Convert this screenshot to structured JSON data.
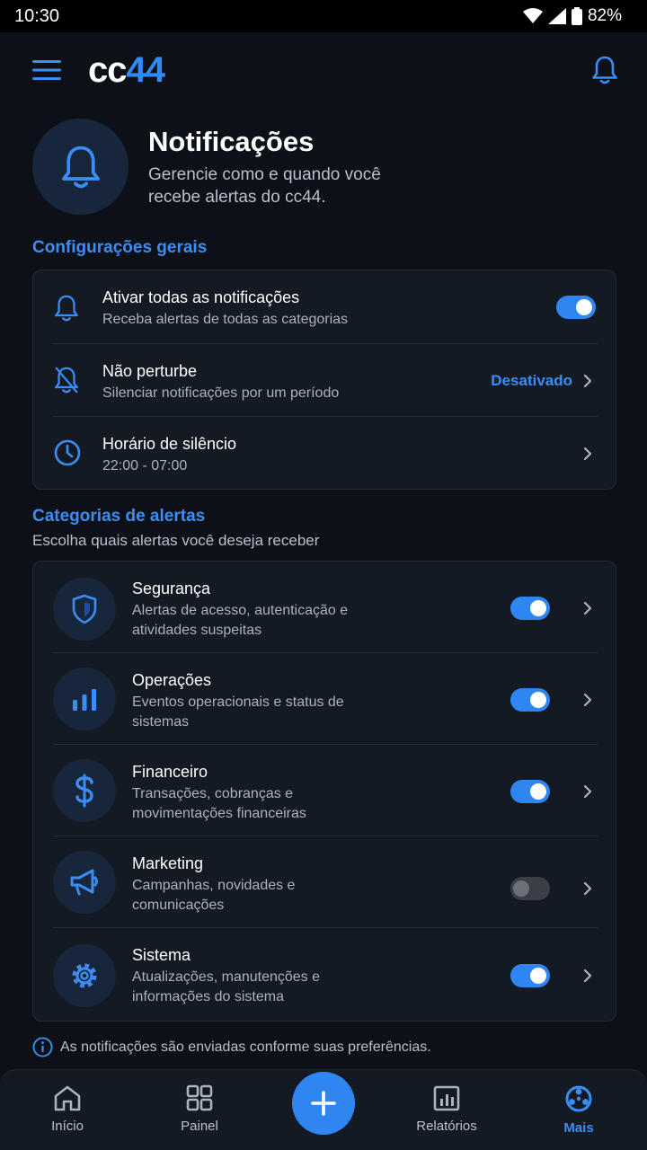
{
  "status_bar": {
    "time": "10:30",
    "battery": "82%"
  },
  "header": {
    "logo_cc": "cc",
    "logo_num": "44"
  },
  "hero": {
    "title": "Notificações",
    "subtitle": "Gerencie como e quando você recebe alertas do cc44."
  },
  "general": {
    "section_title": "Configurações gerais",
    "rows": [
      {
        "title": "Ativar todas as notificações",
        "subtitle": "Receba alertas de todas as categorias",
        "enabled": true
      },
      {
        "title": "Não perturbe",
        "subtitle": "Silenciar notificações por um período",
        "status": "Desativado"
      },
      {
        "title": "Horário de silêncio",
        "subtitle": "22:00 - 07:00"
      }
    ]
  },
  "categories": {
    "section_title": "Categorias de alertas",
    "section_subtitle": "Escolha quais alertas você deseja receber",
    "items": [
      {
        "title": "Segurança",
        "subtitle": "Alertas de acesso, autenticação e atividades suspeitas",
        "icon": "shield-icon",
        "enabled": true
      },
      {
        "title": "Operações",
        "subtitle": "Eventos operacionais e status de sistemas",
        "icon": "bar-chart-icon",
        "enabled": true
      },
      {
        "title": "Financeiro",
        "subtitle": "Transações, cobranças e movimentações financeiras",
        "icon": "dollar-icon",
        "enabled": true
      },
      {
        "title": "Marketing",
        "subtitle": "Campanhas, novidades e comunicações",
        "icon": "megaphone-icon",
        "enabled": false
      },
      {
        "title": "Sistema",
        "subtitle": "Atualizações, manutenções e informações do sistema",
        "icon": "gear-icon",
        "enabled": true
      }
    ]
  },
  "info_note": "As notificações são enviadas conforme suas preferências.",
  "bottom_nav": {
    "items": [
      {
        "label": "Início",
        "icon": "home-icon"
      },
      {
        "label": "Painel",
        "icon": "grid-icon"
      },
      {
        "label": "Relatórios",
        "icon": "report-icon"
      },
      {
        "label": "Mais",
        "icon": "more-icon",
        "active": true
      }
    ]
  },
  "colors": {
    "accent": "#2f86f0",
    "background": "#0d1117",
    "card": "#141a23"
  }
}
